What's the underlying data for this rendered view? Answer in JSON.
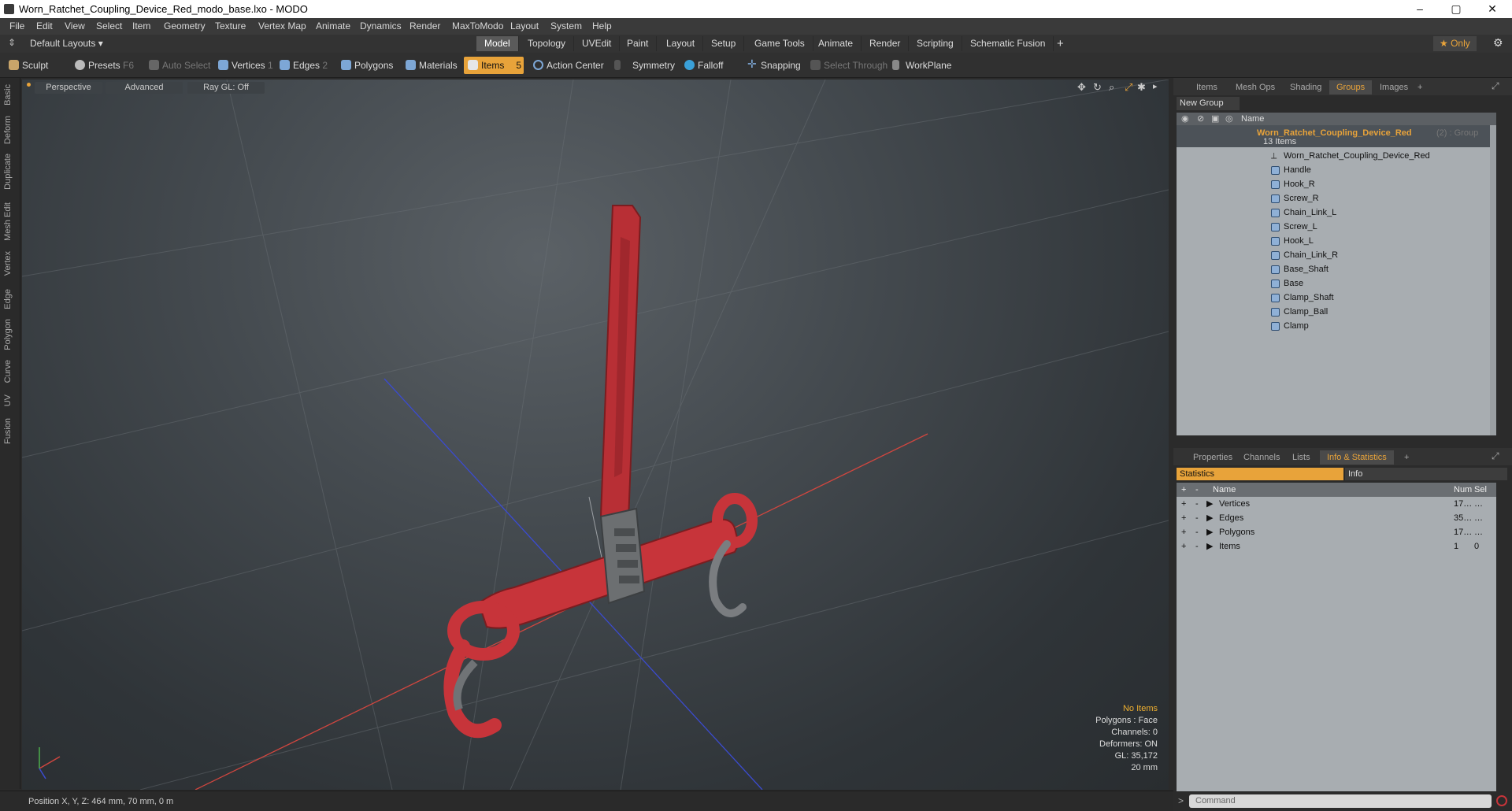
{
  "window": {
    "title": "Worn_Ratchet_Coupling_Device_Red_modo_base.lxo - MODO",
    "minimize": "–",
    "maximize": "▢",
    "close": "✕"
  },
  "menu": [
    "File",
    "Edit",
    "View",
    "Select",
    "Item",
    "Geometry",
    "Texture",
    "Vertex Map",
    "Animate",
    "Dynamics",
    "Render",
    "MaxToModo",
    "Layout",
    "System",
    "Help"
  ],
  "layouts": {
    "label": "Default Layouts ▾",
    "only": "★ Only"
  },
  "tabs": [
    "Model",
    "Topology",
    "UVEdit",
    "Paint",
    "Layout",
    "Setup",
    "Game Tools",
    "Animate",
    "Render",
    "Scripting",
    "Schematic Fusion",
    "+"
  ],
  "toolbar": {
    "sculpt": "Sculpt",
    "presets": "Presets",
    "presets_key": "F6",
    "auto_select": "Auto Select",
    "vertices": "Vertices",
    "vertices_count": "1",
    "edges": "Edges",
    "edges_count": "2",
    "polygons": "Polygons",
    "materials": "Materials",
    "items": "Items",
    "items_count": "5",
    "action_center": "Action Center",
    "symmetry": "Symmetry",
    "falloff": "Falloff",
    "snapping": "Snapping",
    "select_through": "Select Through",
    "workplane": "WorkPlane"
  },
  "left_tabs": [
    "Basic",
    "Deform",
    "Duplicate",
    "Mesh Edit",
    "Vertex",
    "Edge",
    "Polygon",
    "Curve",
    "UV",
    "Fusion"
  ],
  "viewport": {
    "view": "Perspective",
    "shading": "Advanced",
    "raygl": "Ray GL: Off"
  },
  "hud": {
    "items": "No Items",
    "polygons": "Polygons : Face",
    "channels": "Channels: 0",
    "deformers": "Deformers: ON",
    "gl": "GL: 35,172",
    "scale": "20 mm"
  },
  "status": {
    "position": "Position X, Y, Z:   464 mm, 70 mm, 0 m"
  },
  "groups_panel": {
    "tabs": [
      "Items",
      "Mesh Ops",
      "Shading",
      "Groups",
      "Images",
      "+"
    ],
    "new_group": "New Group",
    "name_header": "Name",
    "group_name": "Worn_Ratchet_Coupling_Device_Red",
    "group_suffix": "(2) : Group",
    "group_count": "13 Items",
    "items": [
      "Worn_Ratchet_Coupling_Device_Red",
      "Handle",
      "Hook_R",
      "Screw_R",
      "Chain_Link_L",
      "Screw_L",
      "Hook_L",
      "Chain_Link_R",
      "Base_Shaft",
      "Base",
      "Clamp_Shaft",
      "Clamp_Ball",
      "Clamp"
    ]
  },
  "info_panel": {
    "tabs": [
      "Properties",
      "Channels",
      "Lists",
      "Info & Statistics",
      "+"
    ],
    "statistics": "Statistics",
    "info": "Info",
    "headers": {
      "name": "Name",
      "num": "Num",
      "sel": "Sel"
    },
    "rows": [
      {
        "name": "Vertices",
        "num": "17…",
        "sel": "…"
      },
      {
        "name": "Edges",
        "num": "35…",
        "sel": "…"
      },
      {
        "name": "Polygons",
        "num": "17…",
        "sel": "…"
      },
      {
        "name": "Items",
        "num": "1",
        "sel": "0"
      }
    ]
  },
  "command": {
    "placeholder": "Command"
  },
  "colors": {
    "accent": "#e8a33a",
    "model_red": "#c7343a"
  }
}
